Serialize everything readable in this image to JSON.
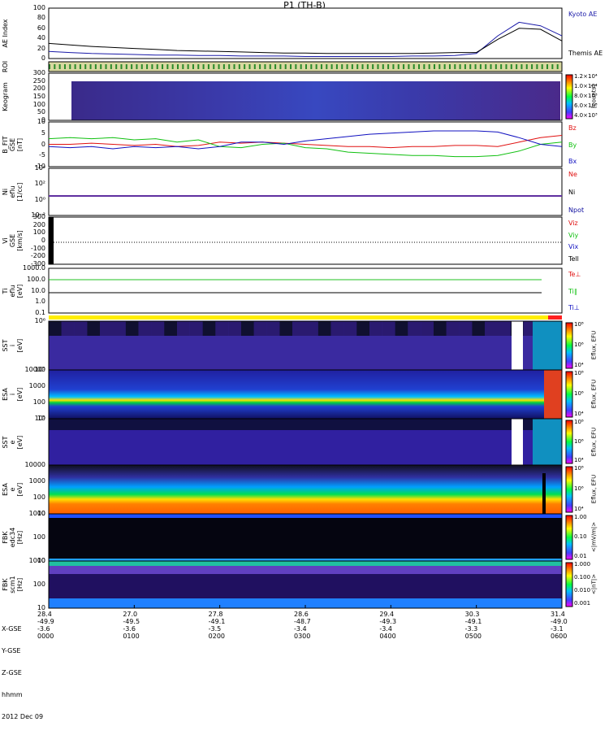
{
  "title": "P1 (TH-B)",
  "colors": {
    "kyoto": "#1a1aa8",
    "themis": "#000000",
    "bz": "#e01010",
    "by": "#10c010",
    "bx": "#1010c0"
  },
  "panels": [
    {
      "id": "ae",
      "ylabel": "AE Index",
      "yticks": [
        "100",
        "80",
        "60",
        "40",
        "20",
        "0"
      ]
    },
    {
      "id": "roi",
      "ylabel": "ROI"
    },
    {
      "id": "keogram",
      "ylabel": "Keogram",
      "yticks": [
        "300",
        "250",
        "200",
        "150",
        "100",
        "50",
        "0"
      ]
    },
    {
      "id": "bfield",
      "ylabel": "B_FIT\nGSE\n[nT]",
      "yticks": [
        "10",
        "5",
        "0",
        "-5",
        "-10"
      ]
    },
    {
      "id": "density",
      "ylabel": "Ni\neflu\n[1/cc]",
      "yticks": [
        "10⁴",
        "10²",
        "10⁰",
        "10⁻²"
      ]
    },
    {
      "id": "velocity",
      "ylabel": "Vi\nGSE\n[km/s]",
      "yticks": [
        "300",
        "200",
        "100",
        "0",
        "-100",
        "-200",
        "-300"
      ]
    },
    {
      "id": "temp",
      "ylabel": "Ti\neflu\n[eV]",
      "yticks": [
        "1000.0",
        "100.0",
        "10.0",
        "1.0",
        "0.1"
      ]
    },
    {
      "id": "sst_ion",
      "ylabel": "SST\ni\n[eV]",
      "yticks": [
        "10⁶",
        "10⁵"
      ]
    },
    {
      "id": "esa_ion",
      "ylabel": "ESA\ni\n[eV]",
      "yticks": [
        "10000",
        "1000",
        "100",
        "10"
      ]
    },
    {
      "id": "sst_e",
      "ylabel": "SST\ne\n[eV]",
      "yticks": [
        "10⁵"
      ]
    },
    {
      "id": "esa_e",
      "ylabel": "ESA\ne\n[eV]",
      "yticks": [
        "10000",
        "1000",
        "100",
        "10"
      ]
    },
    {
      "id": "fbk_e",
      "ylabel": "FBK\nedc34\n[Hz]",
      "yticks": [
        "1000",
        "100",
        "10"
      ]
    },
    {
      "id": "fbk_b",
      "ylabel": "FBK\nscm1\n[Hz]",
      "yticks": [
        "1000",
        "100",
        "10"
      ]
    }
  ],
  "right_labels": {
    "ae": [
      "Kyoto AE",
      "Themis AE"
    ],
    "bfield": [
      "Bz",
      "By",
      "Bx"
    ],
    "density": [
      "Ne",
      "Ni",
      "Npot"
    ],
    "velocity": [
      "Viz",
      "Viy",
      "Vix",
      "Tell"
    ],
    "temp": [
      "Te⊥",
      "Ti∥",
      "Ti⊥"
    ]
  },
  "colorbars": {
    "keogram": {
      "ticks": [
        "1.2×10⁴",
        "1.0×10⁴",
        "8.0×10³",
        "6.0×10³",
        "4.0×10³"
      ],
      "unit": "[counts]"
    },
    "sst_ion": {
      "ticks": [
        "10⁸",
        "10⁶",
        "10⁴"
      ],
      "unit": "Eflux, EFU"
    },
    "esa_ion": {
      "ticks": [
        "10⁸",
        "10⁶",
        "10⁴"
      ],
      "unit": "Eflux, EFU"
    },
    "sst_e": {
      "ticks": [
        "10⁸",
        "10⁶",
        "10⁴"
      ],
      "unit": "Eflux, EFU"
    },
    "esa_e": {
      "ticks": [
        "10⁸",
        "10⁶",
        "10⁴"
      ],
      "unit": "Eflux, EFU"
    },
    "fbk_e": {
      "ticks": [
        "1.00",
        "0.10",
        "0.01"
      ],
      "unit": "<|mV/m|>"
    },
    "fbk_b": {
      "ticks": [
        "1.000",
        "0.100",
        "0.010",
        "0.001"
      ],
      "unit": "<|nT|>"
    }
  },
  "footer": {
    "row_labels": [
      "X-GSE",
      "Y-GSE",
      "Z-GSE",
      "hhmm",
      "2012 Dec 09"
    ],
    "columns": [
      [
        "28.4",
        "-49.9",
        "-3.6",
        "0000"
      ],
      [
        "27.0",
        "-49.5",
        "-3.6",
        "0100"
      ],
      [
        "27.8",
        "-49.1",
        "-3.5",
        "0200"
      ],
      [
        "28.6",
        "-48.7",
        "-3.4",
        "0300"
      ],
      [
        "29.4",
        "-49.3",
        "-3.4",
        "0400"
      ],
      [
        "30.3",
        "-49.1",
        "-3.3",
        "0500"
      ],
      [
        "31.4",
        "-49.0",
        "-3.1",
        "0600"
      ]
    ]
  },
  "chart_data": {
    "type": "line",
    "title": "P1 (TH-B)",
    "x": [
      0,
      0.25,
      0.5,
      0.75,
      1,
      1.25,
      1.5,
      1.75,
      2,
      2.25,
      2.5,
      2.75,
      3,
      3.25,
      3.5,
      3.75,
      4,
      4.25,
      4.5,
      4.75,
      5,
      5.25,
      5.5,
      5.75,
      6
    ],
    "xlabel": "hhmm",
    "series": [
      {
        "name": "Kyoto AE",
        "values": [
          14,
          12,
          10,
          9,
          8,
          7,
          7,
          6,
          6,
          5,
          5,
          5,
          4,
          4,
          4,
          4,
          4,
          5,
          5,
          6,
          10,
          45,
          72,
          65,
          45
        ]
      },
      {
        "name": "Themis AE",
        "values": [
          30,
          27,
          24,
          22,
          20,
          18,
          16,
          15,
          14,
          13,
          12,
          11,
          11,
          10,
          10,
          10,
          10,
          10,
          11,
          12,
          12,
          38,
          60,
          58,
          35
        ]
      },
      {
        "name": "Bz",
        "values": [
          0,
          0,
          0.5,
          0,
          -0.5,
          0,
          -1,
          -0.5,
          1,
          0.5,
          1,
          0.5,
          0,
          -0.5,
          -1,
          -1,
          -1.5,
          -1,
          -1,
          -0.5,
          -0.5,
          -1,
          1,
          3,
          4
        ]
      },
      {
        "name": "By",
        "values": [
          2.5,
          3,
          2.5,
          3,
          2,
          2.5,
          1,
          2,
          -1,
          -1.5,
          0,
          0.5,
          -1.5,
          -2,
          -3.5,
          -4,
          -4.5,
          -5,
          -5,
          -5.5,
          -5.5,
          -5,
          -3,
          0,
          1
        ]
      },
      {
        "name": "Bx",
        "values": [
          -1,
          -1.5,
          -1,
          -2,
          -1,
          -1.5,
          -1,
          -2,
          -1,
          1,
          1,
          0,
          1.5,
          2.5,
          3.5,
          4.5,
          5,
          5.5,
          6,
          6,
          6,
          5.5,
          3,
          0,
          -1
        ]
      }
    ],
    "ylim_ae": [
      0,
      100
    ],
    "ylim_b": [
      -10,
      10
    ]
  }
}
